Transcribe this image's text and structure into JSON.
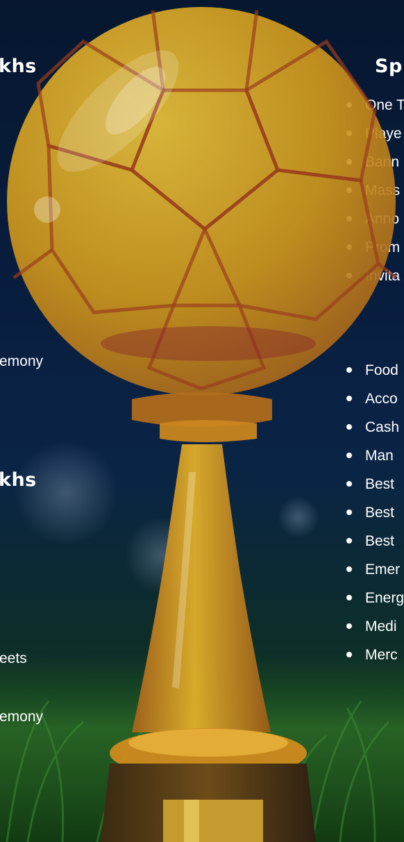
{
  "left_column": {
    "heading_1": "khs",
    "line_1": "emony",
    "heading_2": "khs",
    "line_2": "eets",
    "line_3": "emony"
  },
  "right_column": {
    "heading": "Sp",
    "list_1": [
      "One T",
      "Playe",
      "Bann",
      "Mass",
      "Anno",
      "Prom",
      "Invita"
    ],
    "list_2": [
      "Food",
      "Acco",
      "Cash",
      "Man",
      "Best",
      "Best",
      "Best",
      "Emer",
      "Energ",
      "Medi",
      "Merc"
    ]
  },
  "colors": {
    "background_top": "#06172f",
    "background_bottom": "#11331b",
    "trophy_gold": "#d6a51f",
    "trophy_seams": "#9a3d1d",
    "text": "#ffffff"
  },
  "icons": {
    "trophy": "soccer-ball-trophy-icon"
  }
}
